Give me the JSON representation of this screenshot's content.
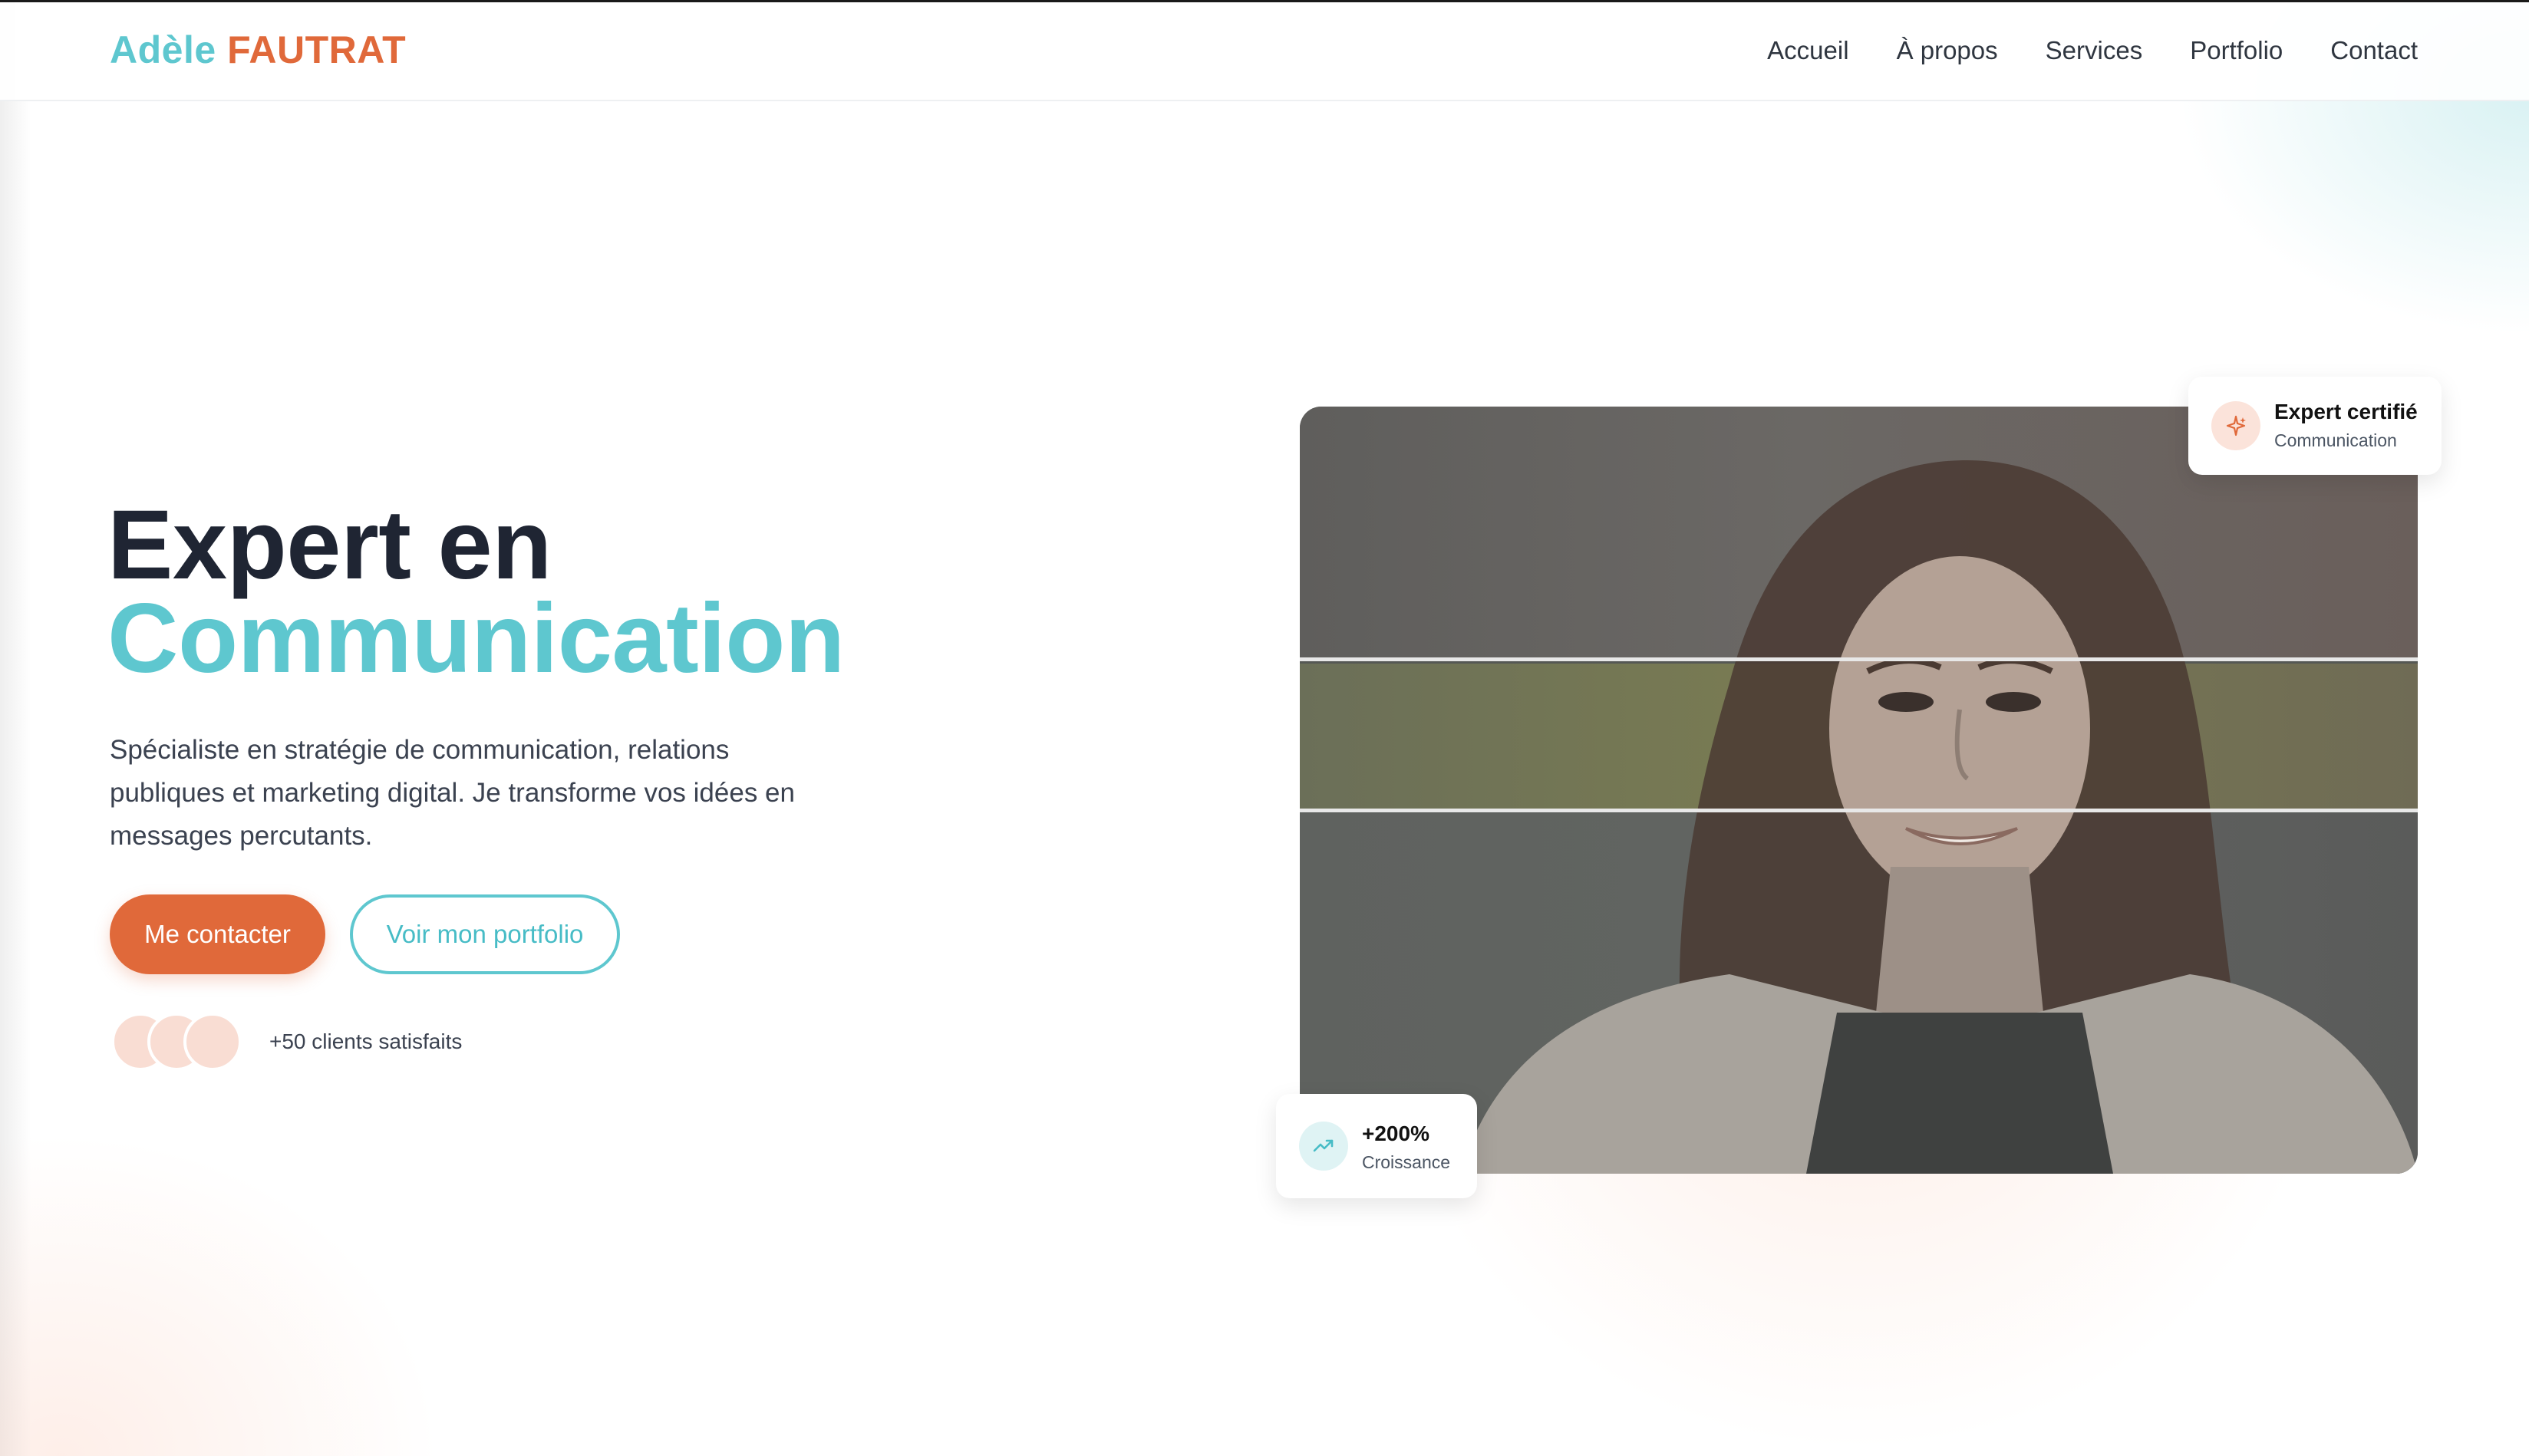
{
  "header": {
    "logo_first": "Adèle",
    "logo_last": "FAUTRAT",
    "nav": [
      "Accueil",
      "À propos",
      "Services",
      "Portfolio",
      "Contact"
    ]
  },
  "hero": {
    "title_line1": "Expert en",
    "title_line2": "Communication",
    "description": "Spécialiste en stratégie de communication, relations publiques et marketing digital. Je transforme vos idées en messages percutants.",
    "primary_button": "Me contacter",
    "secondary_button": "Voir mon portfolio",
    "clients_text": "+50 clients satisfaits"
  },
  "badges": {
    "expert": {
      "title": "Expert certifié",
      "subtitle": "Communication",
      "icon": "sparkles-icon"
    },
    "growth": {
      "title": "+200%",
      "subtitle": "Croissance",
      "icon": "trending-up-icon"
    }
  },
  "colors": {
    "accent_teal": "#5ec7cf",
    "accent_orange": "#e0693a",
    "heading_dark": "#1f2533"
  }
}
